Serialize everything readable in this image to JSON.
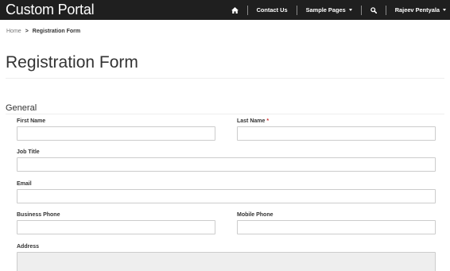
{
  "navbar": {
    "brand": "Custom Portal",
    "contact_us": "Contact Us",
    "sample_pages": "Sample Pages",
    "user": "Rajeev Pentyala"
  },
  "breadcrumb": {
    "home": "Home",
    "separator": ">",
    "current": "Registration Form"
  },
  "page": {
    "title": "Registration Form"
  },
  "form": {
    "section_title": "General",
    "required_marker": "*",
    "fields": {
      "first_name": {
        "label": "First Name",
        "value": ""
      },
      "last_name": {
        "label": "Last Name",
        "value": ""
      },
      "job_title": {
        "label": "Job Title",
        "value": ""
      },
      "email": {
        "label": "Email",
        "value": ""
      },
      "business_phone": {
        "label": "Business Phone",
        "value": ""
      },
      "mobile_phone": {
        "label": "Mobile Phone",
        "value": ""
      },
      "address": {
        "label": "Address",
        "value": ""
      }
    }
  },
  "colors": {
    "navbar_bg": "#1f1f1f",
    "required": "#cc3333",
    "readonly_bg": "#eeeeee"
  },
  "icons": {
    "home": "home-icon",
    "search": "search-icon"
  }
}
